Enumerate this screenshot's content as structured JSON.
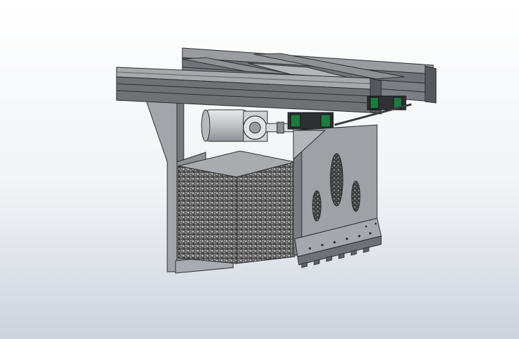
{
  "viewport": {
    "background_top": "#ffffff",
    "background_bottom": "#cdd3dd",
    "colors": {
      "rail_top": "#9a9c9f",
      "rail_front": "#6f7275",
      "rail_edge": "#2b2d30",
      "plate_face": "#9ea1a6",
      "plate_dark": "#6e7176",
      "plate_edge": "#2a2c2f",
      "foam_dark": "#3d3d3d",
      "foam_light": "#bdbdbd",
      "carriage_green": "#1e7a3e",
      "motor_body": "#c9cbce"
    }
  },
  "model": {
    "rails": "aluminum-extrusion-rail-frame",
    "carriages": "linear-guide-carriages",
    "motor": "drive-motor-cylinder",
    "side_plates": "side-mounting-plates",
    "foam_block": "foam-block-textured",
    "slots": "plate-cutout-slots"
  }
}
